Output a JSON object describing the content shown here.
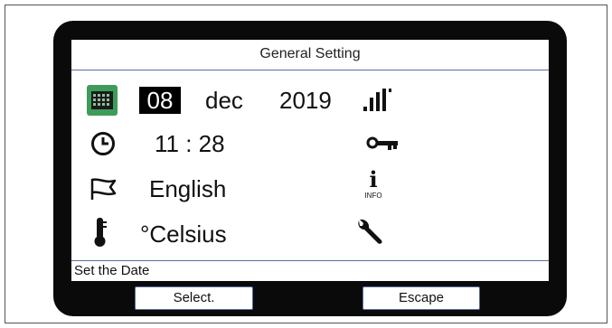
{
  "screen": {
    "title": "General Setting",
    "date": {
      "day": "08",
      "month": "dec",
      "year": "2019"
    },
    "time": "11 : 28",
    "language": "English",
    "temperature_unit": "°Celsius",
    "info_label": "INFO",
    "info_letter": "i",
    "status_text": "Set the Date"
  },
  "softkeys": {
    "left": "Select.",
    "right": "Escape"
  },
  "icons": {
    "calendar": "calendar-icon",
    "signal": "signal-icon",
    "clock": "clock-icon",
    "key": "key-icon",
    "flag": "flag-icon",
    "info": "info-icon",
    "thermometer": "thermometer-icon",
    "wrench": "wrench-icon"
  },
  "colors": {
    "bezel": "#0a0a0a",
    "screen_bg": "#ffffff",
    "highlight": "#3e9c5a",
    "divider": "#5a6d9a"
  }
}
